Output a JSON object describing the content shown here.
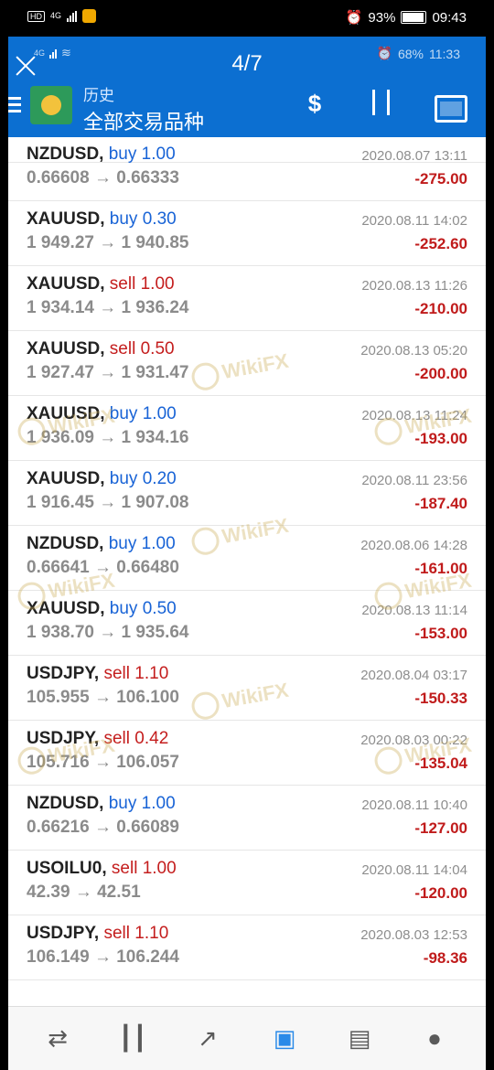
{
  "status_bar": {
    "badge": "HD",
    "network": "4G",
    "battery": "93%",
    "time": "09:43"
  },
  "inner_status": {
    "network": "4G",
    "battery": "68%",
    "time": "11:33"
  },
  "viewer": {
    "pager": "4/7"
  },
  "header": {
    "subtitle": "历史",
    "title": "全部交易品种"
  },
  "icons": {
    "top": [
      "currency-exchange-icon",
      "sort-icon",
      "calendar-icon"
    ],
    "nav": [
      "trade-arrows-icon",
      "candlestick-chart-icon",
      "trend-chart-icon",
      "history-inbox-icon",
      "news-icon",
      "chat-icon"
    ],
    "active_nav_color": "#2a8ae8"
  },
  "watermark": "WikiFX",
  "trades": [
    {
      "symbol": "NZDUSD,",
      "side": "buy",
      "volume": "1.00",
      "prices": "0.66608 → 0.66333",
      "date": "2020.08.07 13:11",
      "profit": "-275.00"
    },
    {
      "symbol": "XAUUSD,",
      "side": "buy",
      "volume": "0.30",
      "prices": "1 949.27 → 1 940.85",
      "date": "2020.08.11 14:02",
      "profit": "-252.60"
    },
    {
      "symbol": "XAUUSD,",
      "side": "sell",
      "volume": "1.00",
      "prices": "1 934.14 → 1 936.24",
      "date": "2020.08.13 11:26",
      "profit": "-210.00"
    },
    {
      "symbol": "XAUUSD,",
      "side": "sell",
      "volume": "0.50",
      "prices": "1 927.47 → 1 931.47",
      "date": "2020.08.13 05:20",
      "profit": "-200.00"
    },
    {
      "symbol": "XAUUSD,",
      "side": "buy",
      "volume": "1.00",
      "prices": "1 936.09 → 1 934.16",
      "date": "2020.08.13 11:24",
      "profit": "-193.00"
    },
    {
      "symbol": "XAUUSD,",
      "side": "buy",
      "volume": "0.20",
      "prices": "1 916.45 → 1 907.08",
      "date": "2020.08.11 23:56",
      "profit": "-187.40"
    },
    {
      "symbol": "NZDUSD,",
      "side": "buy",
      "volume": "1.00",
      "prices": "0.66641 → 0.66480",
      "date": "2020.08.06 14:28",
      "profit": "-161.00"
    },
    {
      "symbol": "XAUUSD,",
      "side": "buy",
      "volume": "0.50",
      "prices": "1 938.70 → 1 935.64",
      "date": "2020.08.13 11:14",
      "profit": "-153.00"
    },
    {
      "symbol": "USDJPY,",
      "side": "sell",
      "volume": "1.10",
      "prices": "105.955 → 106.100",
      "date": "2020.08.04 03:17",
      "profit": "-150.33"
    },
    {
      "symbol": "USDJPY,",
      "side": "sell",
      "volume": "0.42",
      "prices": "105.716 → 106.057",
      "date": "2020.08.03 00:22",
      "profit": "-135.04"
    },
    {
      "symbol": "NZDUSD,",
      "side": "buy",
      "volume": "1.00",
      "prices": "0.66216 → 0.66089",
      "date": "2020.08.11 10:40",
      "profit": "-127.00"
    },
    {
      "symbol": "USOILU0,",
      "side": "sell",
      "volume": "1.00",
      "prices": "42.39 → 42.51",
      "date": "2020.08.11 14:04",
      "profit": "-120.00"
    },
    {
      "symbol": "USDJPY,",
      "side": "sell",
      "volume": "1.10",
      "prices": "106.149 → 106.244",
      "date": "2020.08.03 12:53",
      "profit": "-98.36"
    }
  ]
}
